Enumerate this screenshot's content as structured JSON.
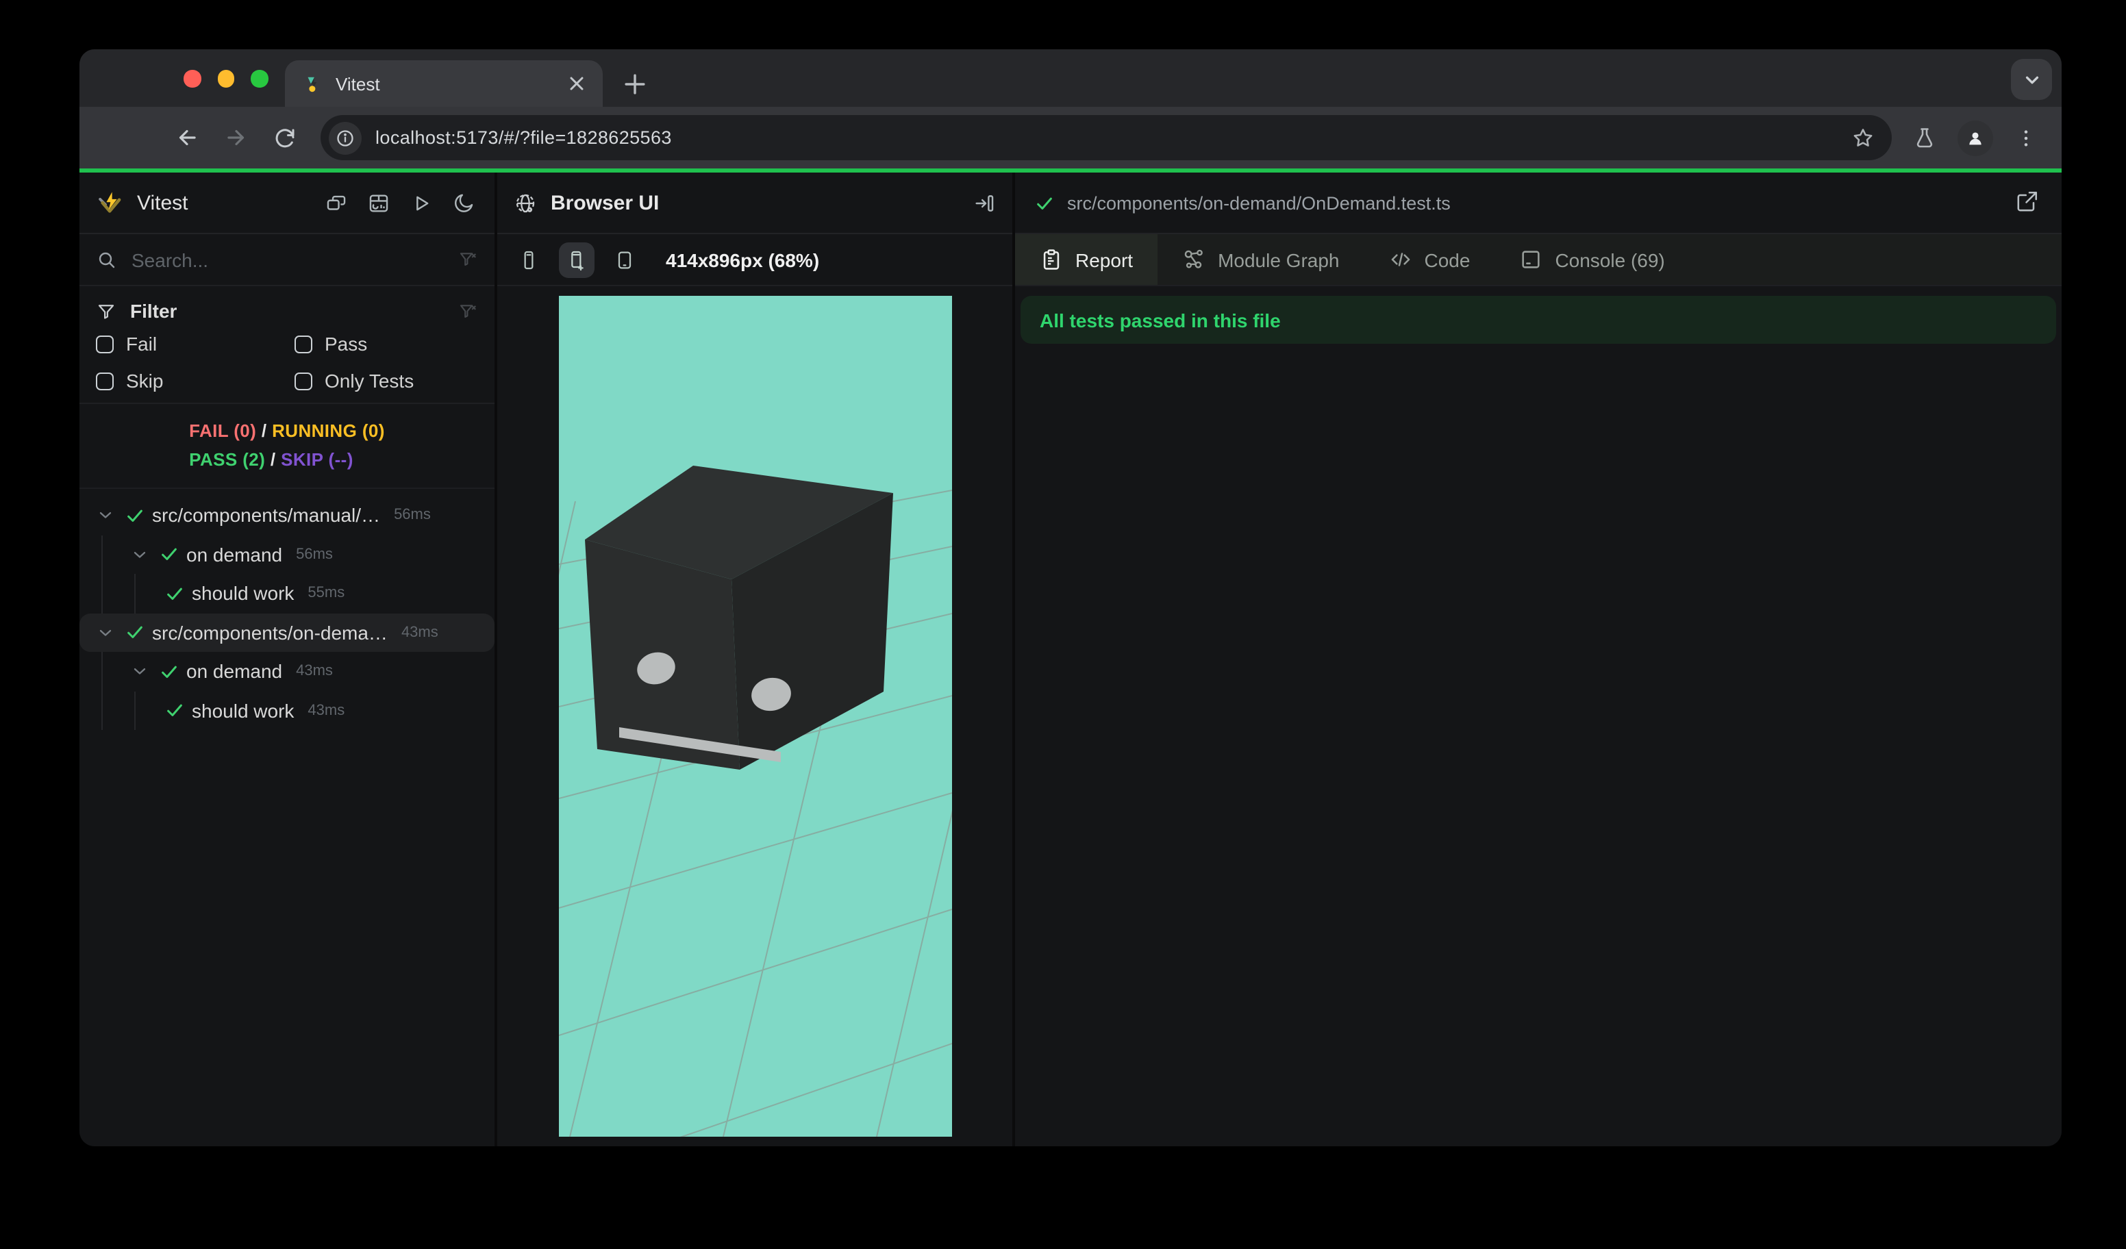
{
  "browser_chrome": {
    "tab_title": "Vitest",
    "url": "localhost:5173/#/?file=1828625563"
  },
  "sidebar": {
    "app_title": "Vitest",
    "search_placeholder": "Search...",
    "filter_title": "Filter",
    "filters": {
      "fail": "Fail",
      "pass": "Pass",
      "skip": "Skip",
      "only": "Only Tests"
    },
    "summary": {
      "fail": "FAIL (0)",
      "running": "RUNNING (0)",
      "pass": "PASS (2)",
      "skip": "SKIP (--)",
      "slash": "/"
    },
    "tree": [
      {
        "type": "file",
        "label": "src/components/manual/…",
        "duration": "56ms",
        "selected": false
      },
      {
        "type": "suite",
        "label": "on demand",
        "duration": "56ms",
        "selected": false
      },
      {
        "type": "test",
        "label": "should work",
        "duration": "55ms",
        "selected": false
      },
      {
        "type": "file",
        "label": "src/components/on-dema…",
        "duration": "43ms",
        "selected": true
      },
      {
        "type": "suite",
        "label": "on demand",
        "duration": "43ms",
        "selected": false
      },
      {
        "type": "test",
        "label": "should work",
        "duration": "43ms",
        "selected": false
      }
    ]
  },
  "browser_panel": {
    "title": "Browser UI",
    "viewport_size": "414x896px (68%)"
  },
  "report_panel": {
    "file_path": "src/components/on-demand/OnDemand.test.ts",
    "tabs": [
      {
        "label": "Report",
        "active": true
      },
      {
        "label": "Module Graph",
        "active": false
      },
      {
        "label": "Code",
        "active": false
      },
      {
        "label": "Console (69)",
        "active": false
      }
    ],
    "banner": "All tests passed in this file"
  },
  "colors": {
    "accent_green": "#1fc14e",
    "viewport_bg": "#80d9c6",
    "fail": "#f87171",
    "running": "#fbbf24",
    "pass": "#3fd16f",
    "skip": "#8153d1",
    "banner_bg": "#16271c",
    "banner_text": "#2fd56d"
  }
}
